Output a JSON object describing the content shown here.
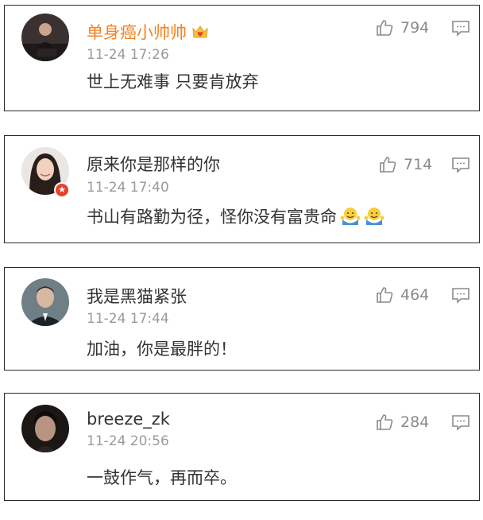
{
  "comments": [
    {
      "username": "单身癌小帅帅",
      "username_color": "#f5821f",
      "badge_icon": "crown-heart-icon",
      "time": "11-24 17:26",
      "text": "世上无难事 只要肯放弃",
      "likes": "794",
      "avatar": "man-sitting-dark-photo"
    },
    {
      "username": "原来你是那样的你",
      "time": "11-24 17:40",
      "text": "书山有路勤为径，怪你没有富贵命",
      "emojis": [
        "shrug-emoji-icon",
        "shrug-emoji-icon"
      ],
      "likes": "714",
      "avatar": "smiling-woman-photo",
      "avatar_badge": "★"
    },
    {
      "username": "我是黑猫紧张",
      "time": "11-24 17:44",
      "text": "加油，你是最胖的！",
      "likes": "464",
      "avatar": "man-suit-photo"
    },
    {
      "username": "breeze_zk",
      "time": "11-24 20:56",
      "text": "一鼓作气，再而卒。",
      "likes": "284",
      "avatar": "man-closeup-photo"
    }
  ],
  "icons": {
    "like": "thumbs-up-icon",
    "comment": "comment-bubble-icon"
  }
}
